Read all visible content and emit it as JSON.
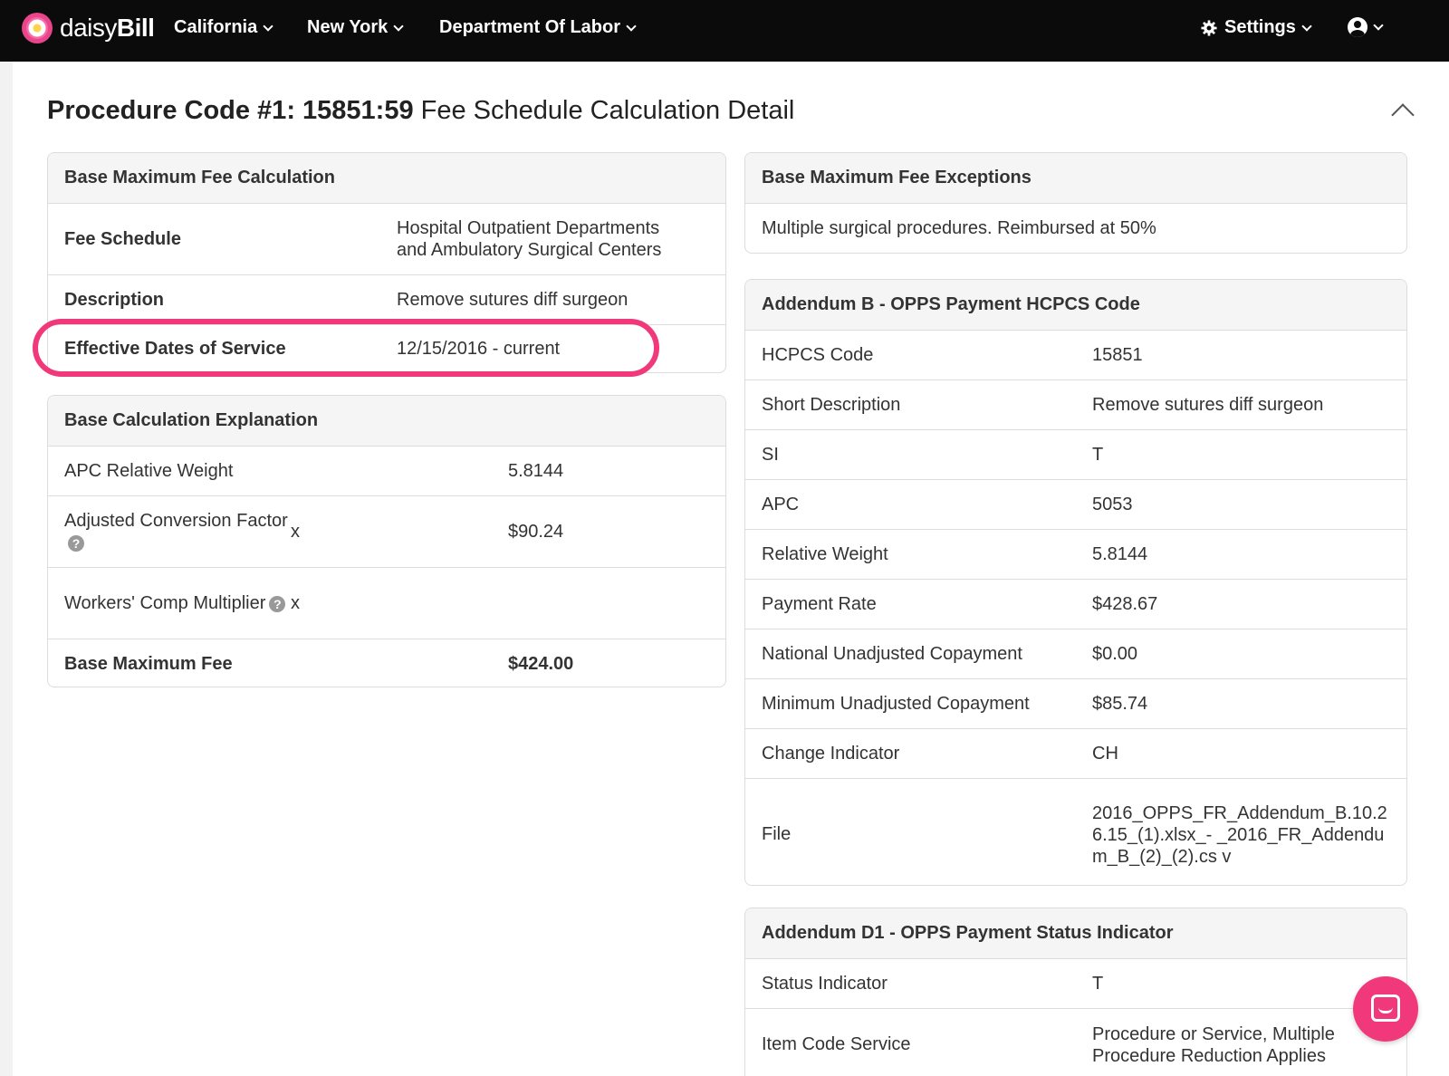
{
  "nav": {
    "brand_light": "daisy",
    "brand_bold": "Bill",
    "items": [
      "California",
      "New York",
      "Department Of Labor"
    ],
    "settings_label": "Settings"
  },
  "page": {
    "title_bold": "Procedure Code #1: 15851:59",
    "title_rest": " Fee Schedule Calculation Detail"
  },
  "base_max_fee_calc": {
    "header": "Base Maximum Fee Calculation",
    "rows": [
      {
        "label": "Fee Schedule",
        "value": "Hospital Outpatient Departments and Ambulatory Surgical Centers"
      },
      {
        "label": "Description",
        "value": "Remove sutures diff surgeon"
      },
      {
        "label": "Effective Dates of Service",
        "value": "12/15/2016 - current"
      }
    ]
  },
  "base_calc_explanation": {
    "header": "Base Calculation Explanation",
    "rows": [
      {
        "label": "APC Relative Weight",
        "op": "",
        "value": "5.8144"
      },
      {
        "label": "Adjusted Conversion Factor",
        "op": "x",
        "value": "$90.24"
      },
      {
        "label": "Workers' Comp Multiplier",
        "op": "x",
        "value": ""
      },
      {
        "label": "Base Maximum Fee",
        "op": "",
        "value": "$424.00"
      }
    ]
  },
  "base_max_fee_exceptions": {
    "header": "Base Maximum Fee Exceptions",
    "text": "Multiple surgical procedures. Reimbursed at 50%"
  },
  "addendum_b": {
    "header": "Addendum B - OPPS Payment HCPCS Code",
    "rows": [
      {
        "label": "HCPCS Code",
        "value": "15851"
      },
      {
        "label": "Short Description",
        "value": "Remove sutures diff surgeon"
      },
      {
        "label": "SI",
        "value": "T"
      },
      {
        "label": "APC",
        "value": "5053"
      },
      {
        "label": "Relative Weight",
        "value": "5.8144"
      },
      {
        "label": "Payment Rate",
        "value": "$428.67"
      },
      {
        "label": "National Unadjusted Copayment",
        "value": "$0.00"
      },
      {
        "label": "Minimum Unadjusted Copayment",
        "value": "$85.74"
      },
      {
        "label": "Change Indicator",
        "value": "CH"
      },
      {
        "label": "File",
        "value": "2016_OPPS_FR_Addendum_B.10.2 6.15_(1).xlsx_- _2016_FR_Addendum_B_(2)_(2).cs v"
      }
    ]
  },
  "addendum_d1": {
    "header": "Addendum D1 - OPPS Payment Status Indicator",
    "rows": [
      {
        "label": "Status Indicator",
        "value": "T"
      },
      {
        "label": "Item Code Service",
        "value": "Procedure or Service, Multiple Procedure Reduction Applies"
      }
    ]
  },
  "colors": {
    "accent": "#f0387a",
    "navbar": "#0b0b0b"
  }
}
